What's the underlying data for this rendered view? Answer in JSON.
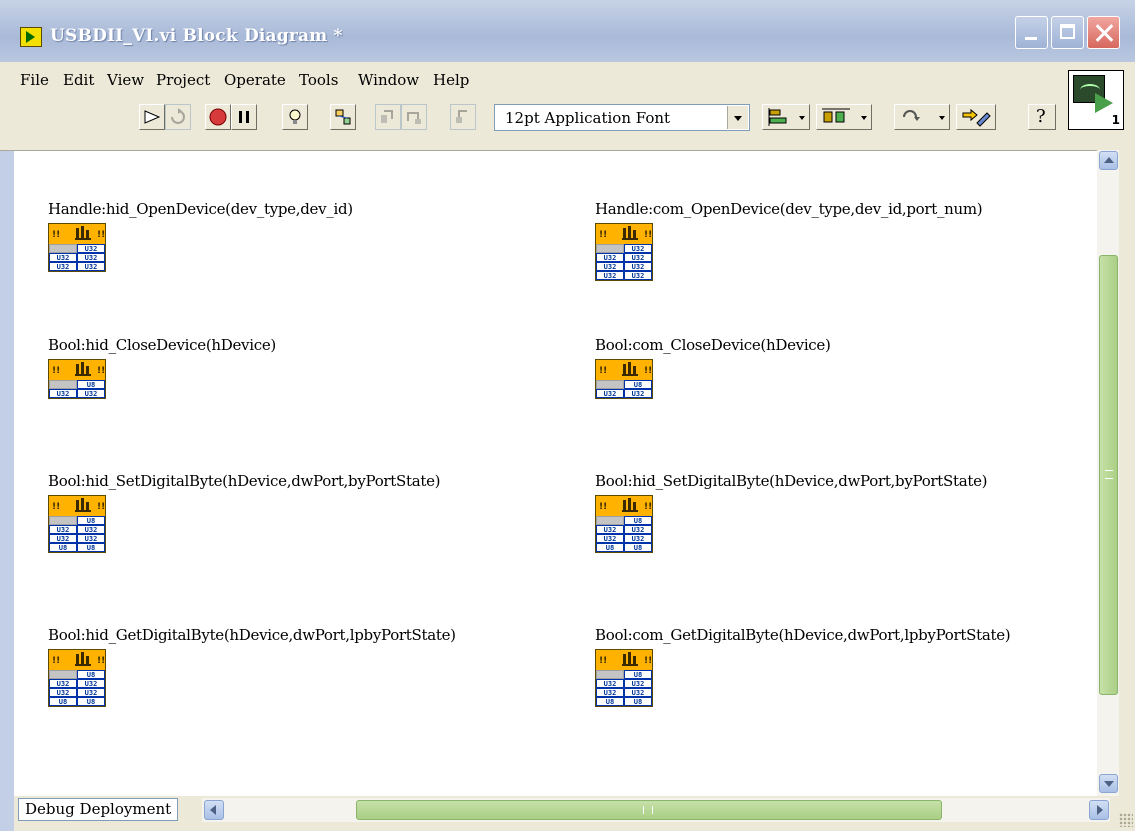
{
  "window": {
    "title": "USBDII_VI.vi Block Diagram *"
  },
  "menu": {
    "items": [
      {
        "label": "File"
      },
      {
        "label": "Edit"
      },
      {
        "label": "View"
      },
      {
        "label": "Project"
      },
      {
        "label": "Operate"
      },
      {
        "label": "Tools"
      },
      {
        "label": "Window"
      },
      {
        "label": "Help"
      }
    ]
  },
  "toolbar": {
    "font_value": "12pt Application Font",
    "icons": [
      "run-arrow-icon",
      "run-continuously-icon",
      "abort-icon",
      "pause-icon",
      "highlight-execution-icon",
      "retain-wire-values-icon",
      "step-into-icon",
      "step-over-icon",
      "step-out-icon"
    ],
    "context_help_label": "?",
    "vi_icon_number": "1"
  },
  "diagram": {
    "nodes": [
      {
        "label": "Handle:hid_OpenDevice(dev_type,dev_id)",
        "rows": [
          [
            "",
            "U32"
          ],
          [
            "U32",
            "U32"
          ],
          [
            "U32",
            "U32"
          ]
        ]
      },
      {
        "label": "Handle:com_OpenDevice(dev_type,dev_id,port_num)",
        "rows": [
          [
            "",
            "U32"
          ],
          [
            "U32",
            "U32"
          ],
          [
            "U32",
            "U32"
          ],
          [
            "U32",
            "U32"
          ]
        ]
      },
      {
        "label": "Bool:hid_CloseDevice(hDevice)",
        "rows": [
          [
            "",
            "U8"
          ],
          [
            "U32",
            "U32"
          ]
        ]
      },
      {
        "label": "Bool:com_CloseDevice(hDevice)",
        "rows": [
          [
            "",
            "U8"
          ],
          [
            "U32",
            "U32"
          ]
        ]
      },
      {
        "label": "Bool:hid_SetDigitalByte(hDevice,dwPort,byPortState)",
        "rows": [
          [
            "",
            "U8"
          ],
          [
            "U32",
            "U32"
          ],
          [
            "U32",
            "U32"
          ],
          [
            "U8",
            "U8"
          ]
        ]
      },
      {
        "label": "Bool:hid_SetDigitalByte(hDevice,dwPort,byPortState)",
        "rows": [
          [
            "",
            "U8"
          ],
          [
            "U32",
            "U32"
          ],
          [
            "U32",
            "U32"
          ],
          [
            "U8",
            "U8"
          ]
        ]
      },
      {
        "label": "Bool:hid_GetDigitalByte(hDevice,dwPort,lpbyPortState)",
        "rows": [
          [
            "",
            "U8"
          ],
          [
            "U32",
            "U32"
          ],
          [
            "U32",
            "U32"
          ],
          [
            "U8",
            "U8"
          ]
        ]
      },
      {
        "label": "Bool:com_GetDigitalByte(hDevice,dwPort,lpbyPortState)",
        "rows": [
          [
            "",
            "U8"
          ],
          [
            "U32",
            "U32"
          ],
          [
            "U32",
            "U32"
          ],
          [
            "U8",
            "U8"
          ]
        ]
      }
    ],
    "node_glyph": "!!"
  },
  "status": {
    "debug_tab": "Debug Deployment"
  },
  "colors": {
    "title_bar": "#b5c4de",
    "node_orange": "#ffb300",
    "scroll_thumb": "#b4d690",
    "terminal_blue": "#0033aa"
  }
}
